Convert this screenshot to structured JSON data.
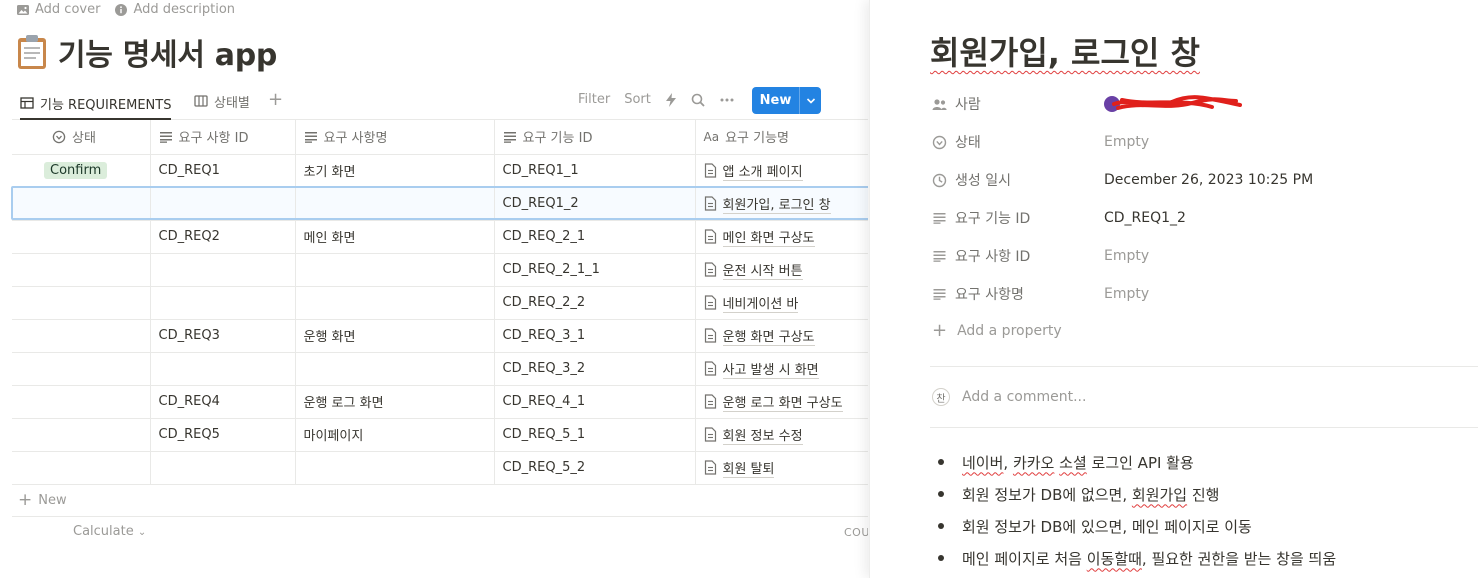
{
  "page": {
    "add_cover": "Add cover",
    "add_description": "Add description",
    "title": "기능 명세서 app"
  },
  "views": {
    "tabs": [
      {
        "label": "기능 REQUIREMENTS",
        "icon": "table-icon",
        "active": true
      },
      {
        "label": "상태별",
        "icon": "board-icon",
        "active": false
      }
    ],
    "filter": "Filter",
    "sort": "Sort",
    "new_button": "New"
  },
  "table": {
    "columns": [
      {
        "label": "상태",
        "icon": "status-icon"
      },
      {
        "label": "요구 사항 ID",
        "icon": "text-icon"
      },
      {
        "label": "요구 사항명",
        "icon": "text-icon"
      },
      {
        "label": "요구 기능 ID",
        "icon": "text-icon"
      },
      {
        "label": "요구 기능명",
        "icon": "title-icon",
        "icon_text": "Aa"
      }
    ],
    "rows": [
      {
        "status": "Confirm",
        "req_id": "CD_REQ1",
        "req_name": "초기 화면",
        "func_id": "CD_REQ1_1",
        "func_name": "앱 소개 페이지"
      },
      {
        "status": "",
        "req_id": "",
        "req_name": "",
        "func_id": "CD_REQ1_2",
        "func_name": "회원가입, 로그인 창"
      },
      {
        "status": "",
        "req_id": "CD_REQ2",
        "req_name": "메인 화면",
        "func_id": "CD_REQ_2_1",
        "func_name": "메인 화면 구상도"
      },
      {
        "status": "",
        "req_id": "",
        "req_name": "",
        "func_id": "CD_REQ_2_1_1",
        "func_name": "운전 시작 버튼"
      },
      {
        "status": "",
        "req_id": "",
        "req_name": "",
        "func_id": "CD_REQ_2_2",
        "func_name": "네비게이션 바"
      },
      {
        "status": "",
        "req_id": "CD_REQ3",
        "req_name": "운행 화면",
        "func_id": "CD_REQ_3_1",
        "func_name": "운행 화면 구상도"
      },
      {
        "status": "",
        "req_id": "",
        "req_name": "",
        "func_id": "CD_REQ_3_2",
        "func_name": "사고 발생 시 화면"
      },
      {
        "status": "",
        "req_id": "CD_REQ4",
        "req_name": "운행 로그 화면",
        "func_id": "CD_REQ_4_1",
        "func_name": "운행 로그 화면 구상도"
      },
      {
        "status": "",
        "req_id": "CD_REQ5",
        "req_name": "마이페이지",
        "func_id": "CD_REQ_5_1",
        "func_name": "회원 정보 수정"
      },
      {
        "status": "",
        "req_id": "",
        "req_name": "",
        "func_id": "CD_REQ_5_2",
        "func_name": "회원 탈퇴"
      }
    ],
    "selected_row": 1,
    "new_row": "New",
    "calculate": "Calculate",
    "count_label": "COU"
  },
  "panel": {
    "title": "회원가입, 로그인 창",
    "properties": [
      {
        "name": "사람",
        "icon": "people-icon",
        "value": "",
        "type": "person"
      },
      {
        "name": "상태",
        "icon": "status-icon",
        "value": "Empty",
        "type": "empty"
      },
      {
        "name": "생성 일시",
        "icon": "clock-icon",
        "value": "December 26, 2023 10:25 PM",
        "type": "value"
      },
      {
        "name": "요구 기능 ID",
        "icon": "text-icon",
        "value": "CD_REQ1_2",
        "type": "value"
      },
      {
        "name": "요구 사항 ID",
        "icon": "text-icon",
        "value": "Empty",
        "type": "empty"
      },
      {
        "name": "요구 사항명",
        "icon": "text-icon",
        "value": "Empty",
        "type": "empty"
      }
    ],
    "add_property": "Add a property",
    "comment_avatar": "찬",
    "comment_placeholder": "Add a comment...",
    "bullets": [
      "네이버, 카카오 소셜 로그인 API 활용",
      "회원 정보가 DB에 없으면, 회원가입 진행",
      "회원 정보가 DB에 있으면, 메인 페이지로 이동",
      "메인 페이지로 처음 이동할때, 필요한 권한을 받는 창을 띄움"
    ]
  },
  "colors": {
    "accent": "#2383e2",
    "confirm_bg": "#dbeddb",
    "selection": "#a9cdef",
    "redaction": "#e0201b"
  }
}
